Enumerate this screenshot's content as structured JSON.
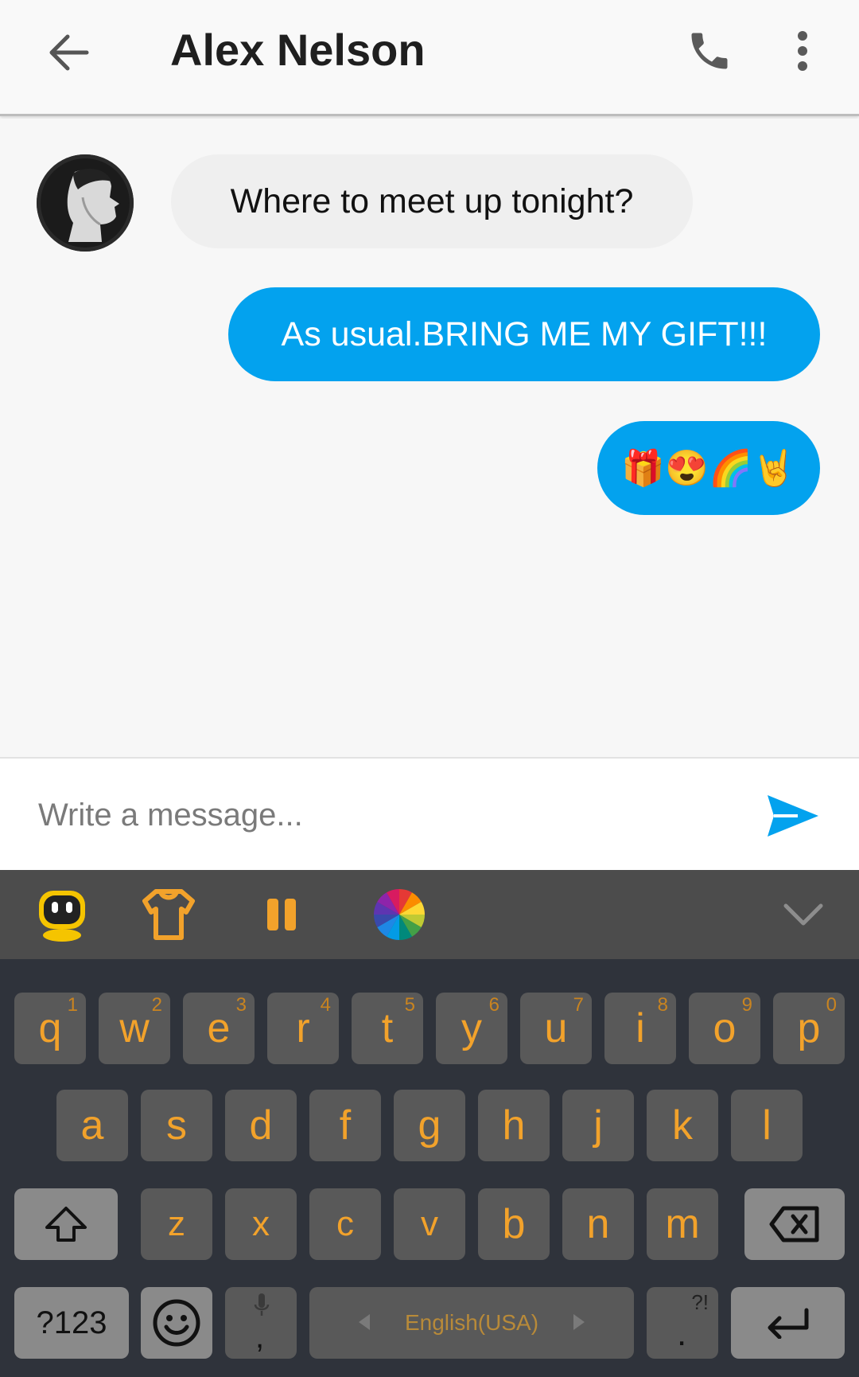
{
  "header": {
    "title": "Alex Nelson"
  },
  "messages": [
    {
      "direction": "incoming",
      "text": "Where to meet up tonight?"
    },
    {
      "direction": "outgoing",
      "text": "As usual.BRING ME MY GIFT!!!"
    },
    {
      "direction": "outgoing",
      "text": "🎁😍🌈🤘"
    }
  ],
  "composer": {
    "placeholder": "Write a message..."
  },
  "keyboard": {
    "row1": [
      {
        "key": "q",
        "hint": "1"
      },
      {
        "key": "w",
        "hint": "2"
      },
      {
        "key": "e",
        "hint": "3"
      },
      {
        "key": "r",
        "hint": "4"
      },
      {
        "key": "t",
        "hint": "5"
      },
      {
        "key": "y",
        "hint": "6"
      },
      {
        "key": "u",
        "hint": "7"
      },
      {
        "key": "i",
        "hint": "8"
      },
      {
        "key": "o",
        "hint": "9"
      },
      {
        "key": "p",
        "hint": "0"
      }
    ],
    "row2": [
      "a",
      "s",
      "d",
      "f",
      "g",
      "h",
      "j",
      "k",
      "l"
    ],
    "row3": [
      "z",
      "x",
      "c",
      "v",
      "b",
      "n",
      "m"
    ],
    "symbols_label": "?123",
    "comma": ",",
    "space_label": "English(USA)",
    "period": ".",
    "period_hint": "?!"
  },
  "colors": {
    "accent": "#03a2ee",
    "key_text": "#f2a22b",
    "keyboard_bg": "#2f333b"
  }
}
